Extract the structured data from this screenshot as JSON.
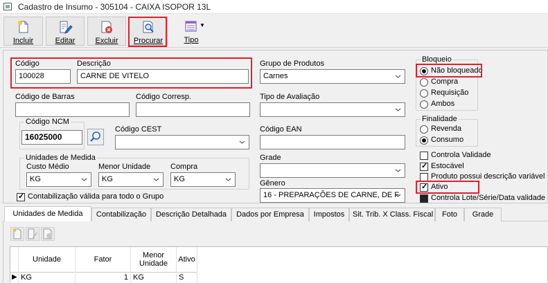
{
  "window": {
    "title": "Cadastro de Insumo - 305104 - CAIXA ISOPOR 13L"
  },
  "toolbar": {
    "incluir": "Incluir",
    "editar": "Editar",
    "excluir": "Excluir",
    "procurar": "Procurar",
    "tipo": "Tipo"
  },
  "form": {
    "codigo_label": "Código",
    "codigo_value": "100028",
    "descricao_label": "Descrição",
    "descricao_value": "CARNE DE VITELO",
    "codigo_barras_label": "Código de Barras",
    "codigo_barras_value": "",
    "codigo_corresp_label": "Código Corresp.",
    "codigo_corresp_value": "",
    "codigo_ncm_label": "Código NCM",
    "codigo_ncm_value": "16025000",
    "codigo_cest_label": "Código CEST",
    "codigo_cest_value": "",
    "grupo_produtos_label": "Grupo de Produtos",
    "grupo_produtos_value": "Carnes",
    "tipo_avaliacao_label": "Tipo de Avaliação",
    "tipo_avaliacao_value": "",
    "codigo_ean_label": "Código EAN",
    "codigo_ean_value": "",
    "grade_label": "Grade",
    "grade_value": "",
    "genero_label": "Gênero",
    "genero_value": "16 - PREPARAÇÕES DE CARNE, DE F",
    "unidades_label": "Unidades de Medida",
    "custo_medio_label": "Custo Médio",
    "custo_medio_value": "KG",
    "menor_unidade_label": "Menor Unidade",
    "menor_unidade_value": "KG",
    "compra_label": "Compra",
    "compra_value": "KG",
    "contabilizacao_label": "Contabilização válida para todo o Grupo"
  },
  "bloqueio": {
    "label": "Bloqueio",
    "options": [
      "Não bloqueado",
      "Compra",
      "Requisição",
      "Ambos"
    ],
    "selected_index": 0
  },
  "finalidade": {
    "label": "Finalidade",
    "options": [
      "Revenda",
      "Consumo"
    ],
    "selected_index": 1
  },
  "checks": {
    "controla_validade": "Controla Validade",
    "estocavel": "Estocável",
    "produto_variavel": "Produto possui descrição variável",
    "ativo": "Ativo",
    "controla_lote": "Controla Lote/Série/Data validade"
  },
  "tabs": [
    "Unidades de Medida",
    "Contabilização",
    "Descrição Detalhada",
    "Dados por Empresa",
    "Impostos",
    "Sit. Trib. X Class. Fiscal",
    "Foto",
    "Grade"
  ],
  "grid": {
    "headers": [
      "Unidade",
      "Fator",
      "Menor Unidade",
      "Ativo"
    ],
    "rows": [
      {
        "unidade": "KG",
        "fator": "1",
        "menor": "KG",
        "ativo": "S"
      }
    ]
  },
  "colors": {
    "highlight": "#e0202e",
    "accent": "#1f6fd0"
  }
}
